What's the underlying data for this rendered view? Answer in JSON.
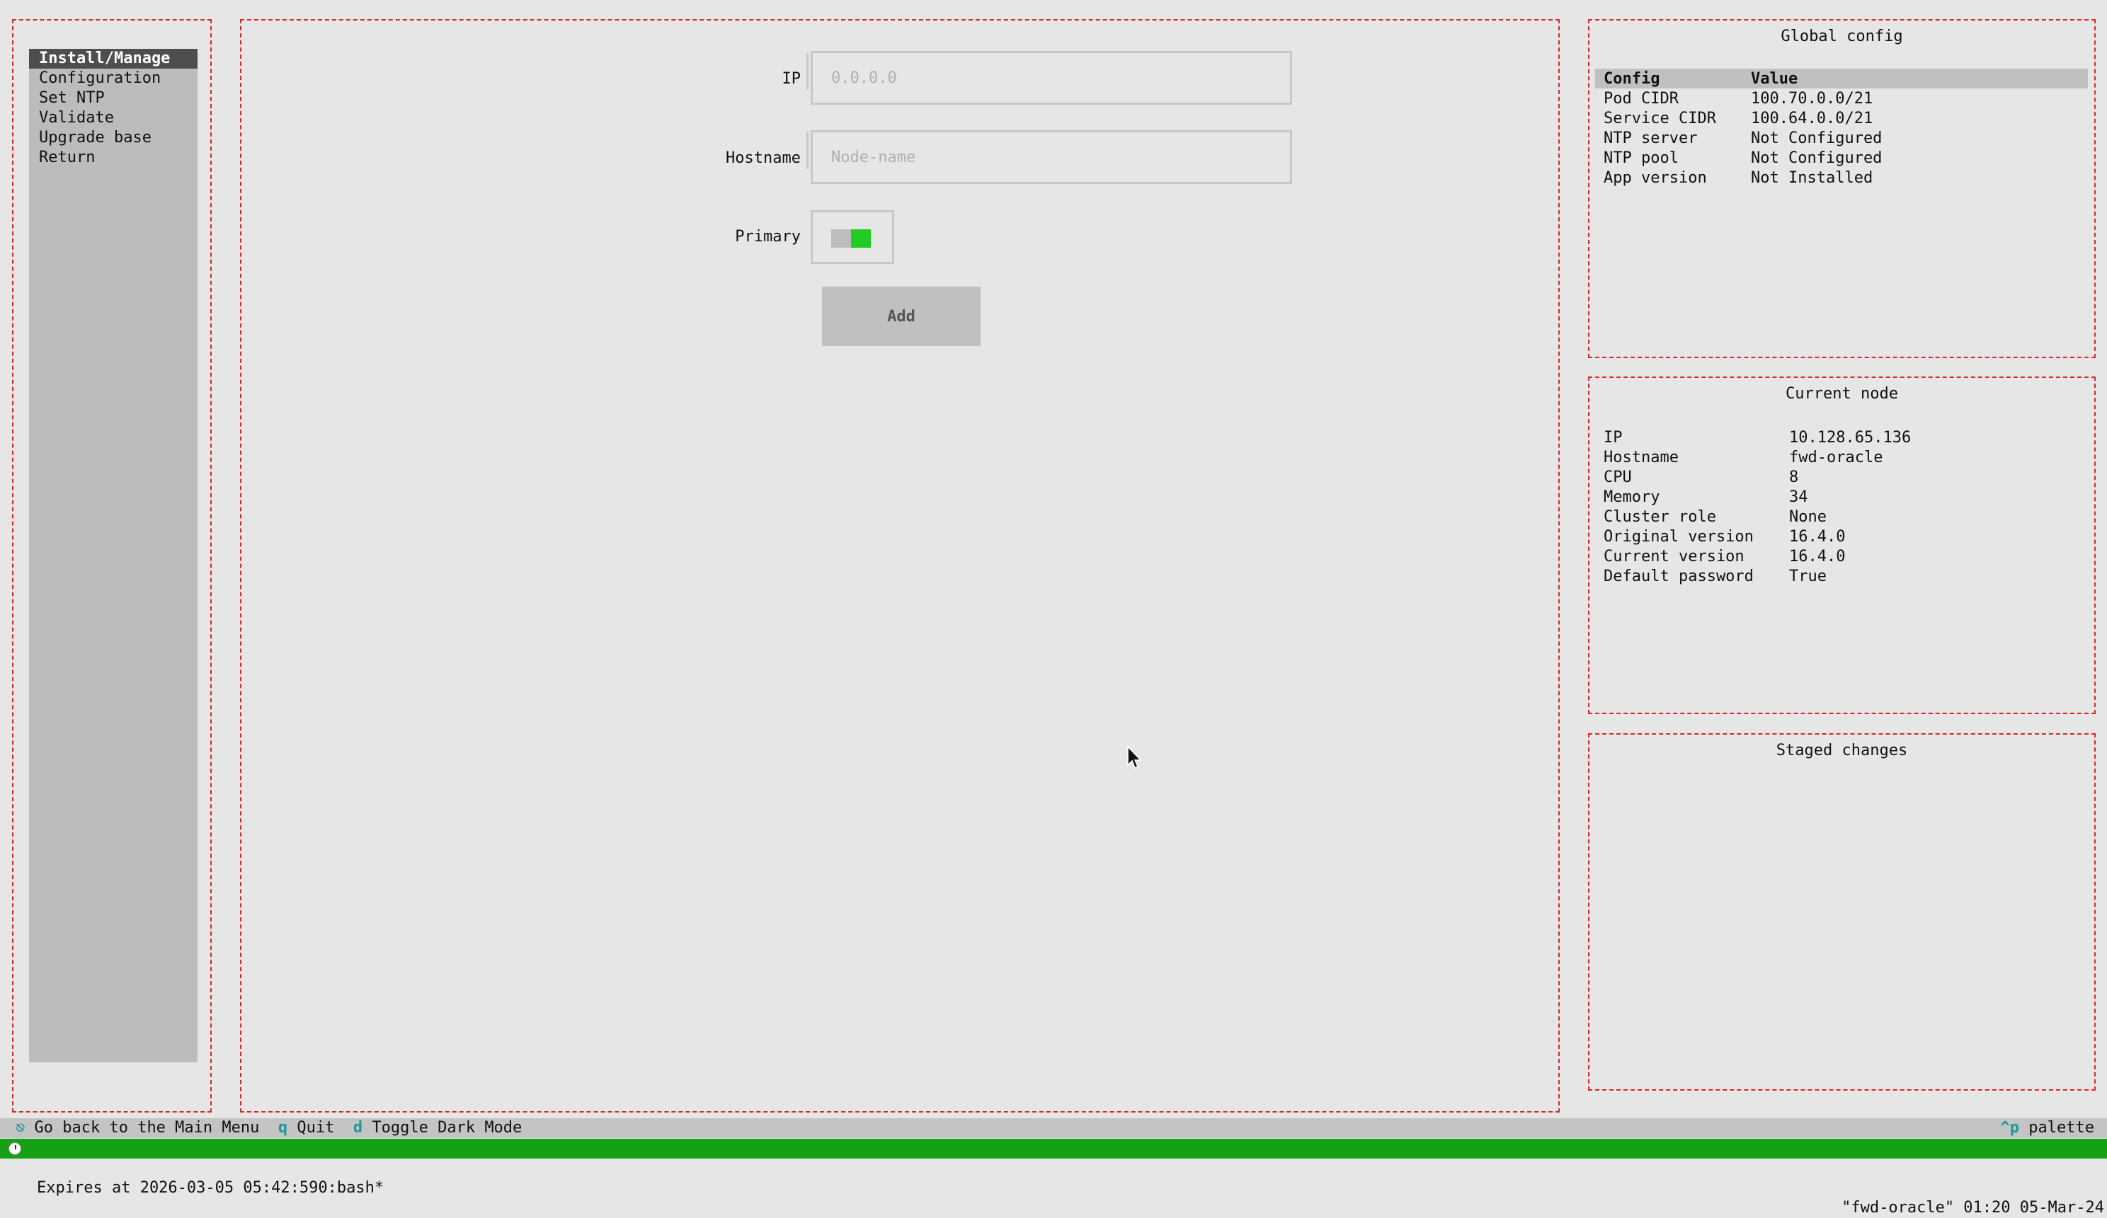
{
  "menu": {
    "items": [
      {
        "label": "Install/Manage",
        "active": true
      },
      {
        "label": "Configuration"
      },
      {
        "label": "Set NTP"
      },
      {
        "label": "Validate"
      },
      {
        "label": "Upgrade base"
      },
      {
        "label": "Return"
      }
    ]
  },
  "form": {
    "ip_label": "IP",
    "ip_placeholder": "0.0.0.0",
    "hostname_label": "Hostname",
    "hostname_placeholder": "Node-name",
    "primary_label": "Primary",
    "primary_on": true,
    "add_label": "Add"
  },
  "global_config": {
    "title": "Global config",
    "header": {
      "config": "Config",
      "value": "Value"
    },
    "rows": [
      {
        "config": "Pod CIDR",
        "value": "100.70.0.0/21"
      },
      {
        "config": "Service CIDR",
        "value": "100.64.0.0/21"
      },
      {
        "config": "NTP server",
        "value": "Not Configured"
      },
      {
        "config": "NTP pool",
        "value": "Not Configured"
      },
      {
        "config": "App version",
        "value": "Not Installed"
      }
    ]
  },
  "current_node": {
    "title": "Current node",
    "rows": [
      {
        "key": "IP",
        "value": "10.128.65.136"
      },
      {
        "key": "Hostname",
        "value": "fwd-oracle"
      },
      {
        "key": "CPU",
        "value": "8"
      },
      {
        "key": "Memory",
        "value": "34"
      },
      {
        "key": "Cluster role",
        "value": "None"
      },
      {
        "key": "Original version",
        "value": "16.4.0"
      },
      {
        "key": "Current version",
        "value": "16.4.0"
      },
      {
        "key": "Default password",
        "value": "True"
      }
    ]
  },
  "staged": {
    "title": "Staged changes"
  },
  "footer": {
    "back_key": "⎋",
    "back_label": "Go back to the Main Menu",
    "quit_key": "q",
    "quit_label": "Quit",
    "dark_key": "d",
    "dark_label": "Toggle Dark Mode",
    "palette_key": "^p",
    "palette_label": "palette"
  },
  "status": {
    "left": "Expires at 2026-03-05 05:42:590:bash*",
    "right": "\"fwd-oracle\" 01:20 05-Mar-24"
  },
  "colors": {
    "border": "#d62828",
    "status": "#15a015",
    "switch_on": "#22cc22",
    "key": "#1e9a9a"
  }
}
